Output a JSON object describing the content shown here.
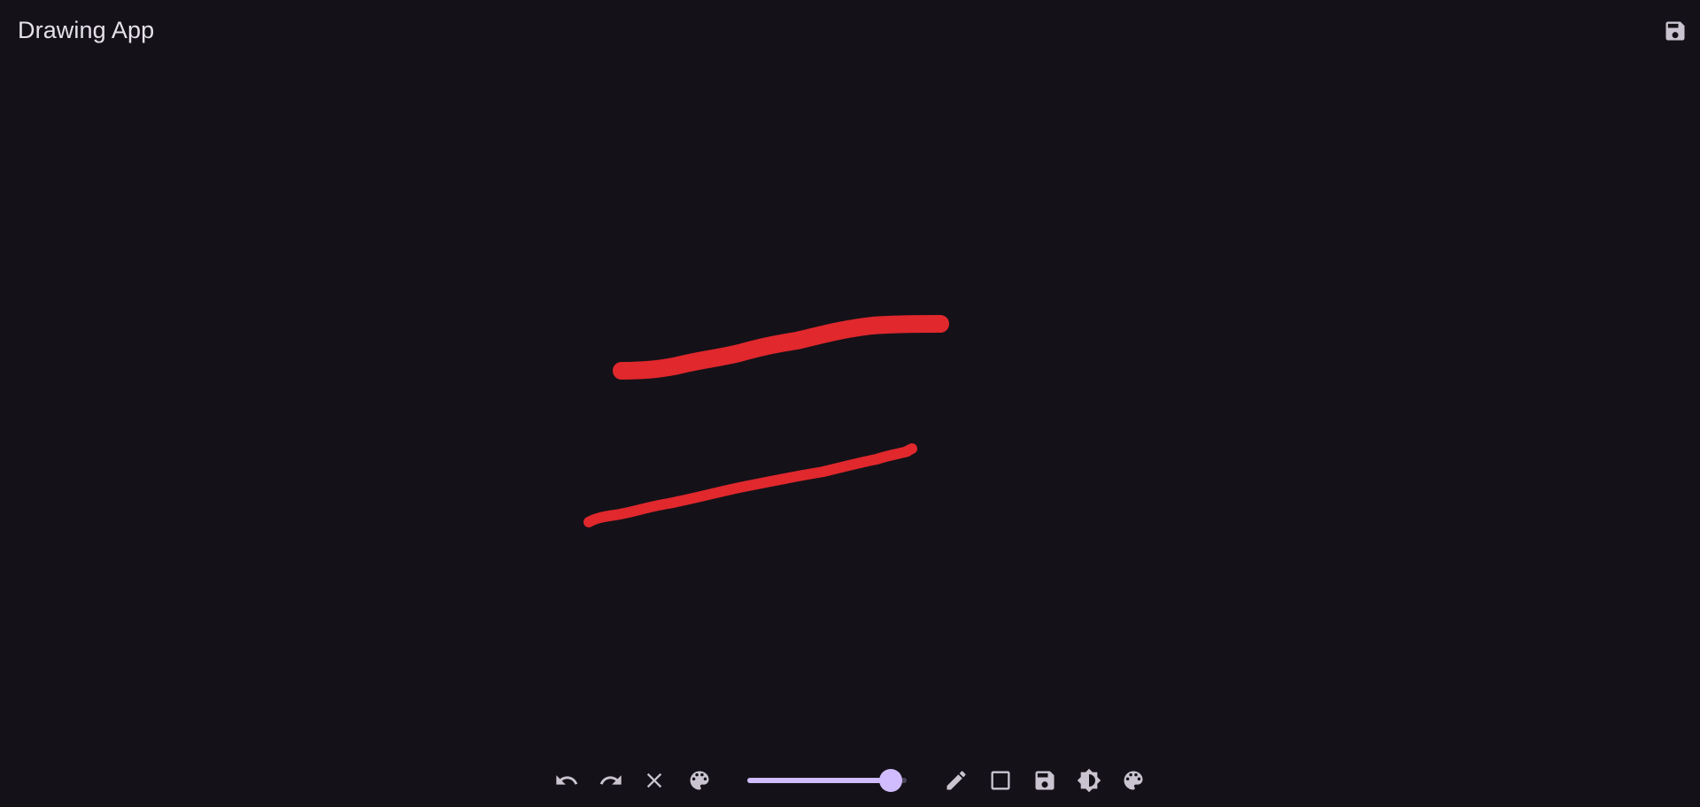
{
  "app": {
    "title": "Drawing App"
  },
  "colors": {
    "background": "#141218",
    "stroke": "#e0282d",
    "icon": "#cac4d0",
    "accent": "#d0bcff"
  },
  "header": {
    "save_icon": "save-icon"
  },
  "toolbar": {
    "tools": [
      {
        "name": "undo",
        "icon": "undo-icon"
      },
      {
        "name": "redo",
        "icon": "redo-icon"
      },
      {
        "name": "clear",
        "icon": "close-icon"
      },
      {
        "name": "color",
        "icon": "palette-icon"
      },
      {
        "name": "pen",
        "icon": "pencil-icon"
      },
      {
        "name": "shape",
        "icon": "square-icon"
      },
      {
        "name": "save",
        "icon": "save-icon"
      },
      {
        "name": "theme",
        "icon": "contrast-icon"
      },
      {
        "name": "palette",
        "icon": "palette-icon"
      }
    ],
    "brush_size": {
      "value_fraction": 0.9
    }
  }
}
